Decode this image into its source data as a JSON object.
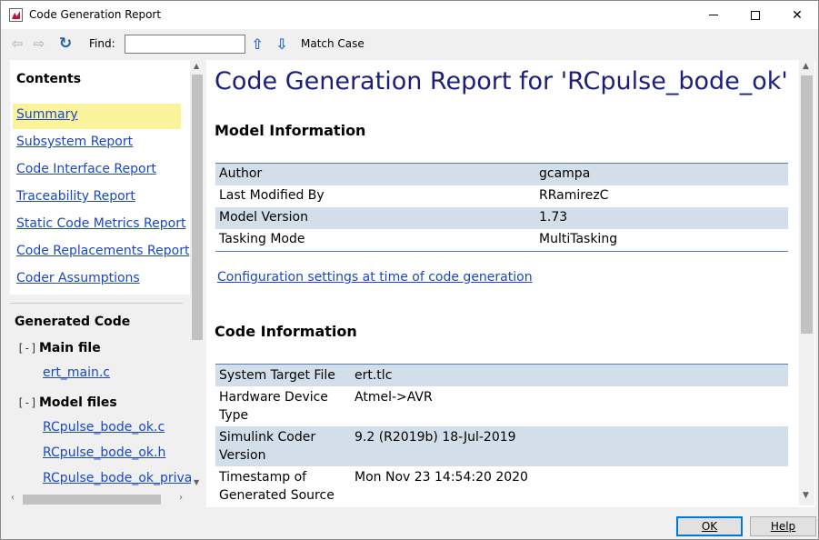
{
  "window": {
    "title": "Code Generation Report"
  },
  "toolbar": {
    "find_label": "Find:",
    "find_value": "",
    "match_case": "Match Case"
  },
  "sidebar": {
    "contents_title": "Contents",
    "links": [
      {
        "label": "Summary",
        "active": true
      },
      {
        "label": "Subsystem Report"
      },
      {
        "label": "Code Interface Report"
      },
      {
        "label": "Traceability Report"
      },
      {
        "label": "Static Code Metrics Report"
      },
      {
        "label": "Code Replacements Report"
      },
      {
        "label": "Coder Assumptions"
      }
    ],
    "generated_code_title": "Generated Code",
    "groups": [
      {
        "toggle": "[-]",
        "label": "Main file",
        "files": [
          "ert_main.c"
        ]
      },
      {
        "toggle": "[-]",
        "label": "Model files",
        "files": [
          "RCpulse_bode_ok.c",
          "RCpulse_bode_ok.h",
          "RCpulse_bode_ok_privat"
        ]
      }
    ]
  },
  "report": {
    "title": "Code Generation Report for 'RCpulse_bode_ok'",
    "model_info_heading": "Model Information",
    "model_info": [
      {
        "key": "Author",
        "value": "gcampa"
      },
      {
        "key": "Last Modified By",
        "value": "RRamirezC"
      },
      {
        "key": "Model Version",
        "value": "1.73"
      },
      {
        "key": "Tasking Mode",
        "value": "MultiTasking"
      }
    ],
    "config_link": "Configuration settings at time of code generation",
    "code_info_heading": "Code Information",
    "code_info": [
      {
        "key": "System Target File",
        "value": "ert.tlc"
      },
      {
        "key": "Hardware Device Type",
        "value": "Atmel->AVR"
      },
      {
        "key": "Simulink Coder Version",
        "value": "9.2 (R2019b) 18-Jul-2019"
      },
      {
        "key": "Timestamp of Generated Source",
        "value": "Mon Nov 23 14:54:20 2020"
      }
    ]
  },
  "buttons": {
    "ok": "OK",
    "help": "Help"
  },
  "colors": {
    "link": "#1a47c7",
    "title": "#1a1f7a",
    "row_shade": "#d3deeb",
    "active_highlight": "#fbf39c"
  }
}
